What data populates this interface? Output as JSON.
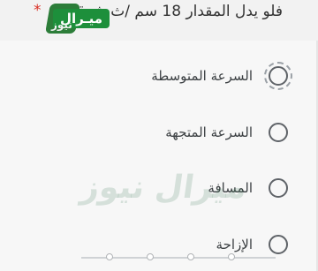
{
  "question": {
    "text": "فلو يدل المقدار 18 سم /ث شرقا\"",
    "required_mark": "*"
  },
  "logo": {
    "text": "ميـرال",
    "subtext": "نيوز"
  },
  "options": [
    {
      "label": "السرعة المتوسطة"
    },
    {
      "label": "السرعة المتجهة"
    },
    {
      "label": "المسافة"
    },
    {
      "label": "الإزاحة"
    }
  ],
  "watermark": {
    "text": "ميرال نيوز"
  }
}
